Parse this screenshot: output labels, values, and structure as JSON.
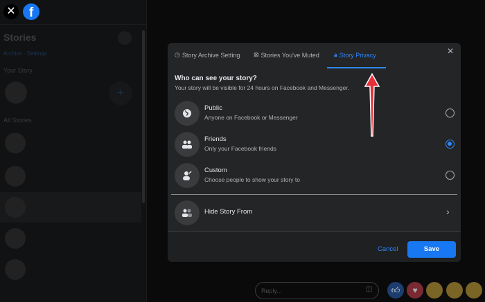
{
  "sidebar": {
    "title": "Stories",
    "links": "Archive · Settings",
    "your_story": "Your Story",
    "all_stories": "All Stories"
  },
  "modal": {
    "tabs": [
      {
        "label": "Story Archive Setting",
        "icon": "clock-icon"
      },
      {
        "label": "Stories You've Muted",
        "icon": "muted-box-icon"
      },
      {
        "label": "Story Privacy",
        "icon": "lock-icon",
        "active": true
      }
    ],
    "question": "Who can see your story?",
    "subtitle": "Your story will be visible for 24 hours on Facebook and Messenger.",
    "options": [
      {
        "title": "Public",
        "desc": "Anyone on Facebook or Messenger",
        "icon": "globe-icon",
        "selected": false
      },
      {
        "title": "Friends",
        "desc": "Only your Facebook friends",
        "icon": "friends-icon",
        "selected": true
      },
      {
        "title": "Custom",
        "desc": "Choose people to show your story to",
        "icon": "custom-person-icon",
        "selected": false
      }
    ],
    "hide_story": "Hide Story From",
    "cancel": "Cancel",
    "save": "Save"
  },
  "reply": {
    "placeholder": "Reply..."
  },
  "colors": {
    "accent": "#1877f2",
    "modal": "#242526",
    "arrow": "#e8303a"
  }
}
